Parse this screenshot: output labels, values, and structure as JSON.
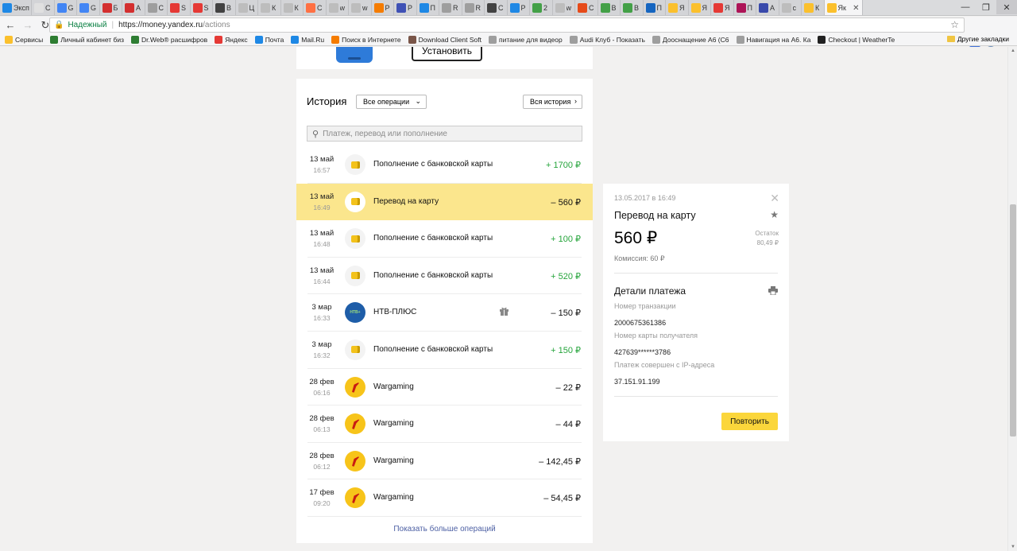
{
  "browser": {
    "tabs": [
      {
        "label": "Эксп",
        "color": "#1e88e5"
      },
      {
        "label": "C",
        "color": "#e0e0e0"
      },
      {
        "label": "G",
        "color": "#4285f4"
      },
      {
        "label": "G",
        "color": "#4285f4"
      },
      {
        "label": "Б",
        "color": "#d32f2f"
      },
      {
        "label": "А",
        "color": "#d32f2f"
      },
      {
        "label": "С",
        "color": "#9e9e9e"
      },
      {
        "label": "S",
        "color": "#e53935"
      },
      {
        "label": "S",
        "color": "#e53935"
      },
      {
        "label": "В",
        "color": "#424242"
      },
      {
        "label": "Ц",
        "color": "#bdbdbd"
      },
      {
        "label": "К",
        "color": "#bdbdbd"
      },
      {
        "label": "К",
        "color": "#bdbdbd"
      },
      {
        "label": "С",
        "color": "#ff7043"
      },
      {
        "label": "w",
        "color": "#bdbdbd"
      },
      {
        "label": "w",
        "color": "#bdbdbd"
      },
      {
        "label": "Р",
        "color": "#f57c00"
      },
      {
        "label": "Р",
        "color": "#3f51b5"
      },
      {
        "label": "П",
        "color": "#1e88e5"
      },
      {
        "label": "R",
        "color": "#9e9e9e"
      },
      {
        "label": "R",
        "color": "#9e9e9e"
      },
      {
        "label": "С",
        "color": "#424242"
      },
      {
        "label": "Р",
        "color": "#1e88e5"
      },
      {
        "label": "2",
        "color": "#43a047"
      },
      {
        "label": "w",
        "color": "#bdbdbd"
      },
      {
        "label": "С",
        "color": "#e64a19"
      },
      {
        "label": "В",
        "color": "#43a047"
      },
      {
        "label": "В",
        "color": "#43a047"
      },
      {
        "label": "П",
        "color": "#1565c0"
      },
      {
        "label": "Я",
        "color": "#fbc02d"
      },
      {
        "label": "Я",
        "color": "#fbc02d"
      },
      {
        "label": "Я",
        "color": "#e53935"
      },
      {
        "label": "П",
        "color": "#ad1457"
      },
      {
        "label": "А",
        "color": "#3949ab"
      },
      {
        "label": "c",
        "color": "#bdbdbd"
      },
      {
        "label": "К",
        "color": "#fbc02d"
      }
    ],
    "active_tab": {
      "label": "Як",
      "color": "#fbc02d"
    },
    "address": {
      "secure_label": "Надежный",
      "host": "https://money.yandex.ru",
      "path": "/actions"
    },
    "bookmarks": [
      {
        "label": "Сервисы",
        "color": "#fbc02d"
      },
      {
        "label": "Личный кабинет биз",
        "color": "#2e7d32"
      },
      {
        "label": "Dr.Web® расшифров",
        "color": "#2e7d32"
      },
      {
        "label": "Яндекс",
        "color": "#e53935"
      },
      {
        "label": "Почта",
        "color": "#1e88e5"
      },
      {
        "label": "Mail.Ru",
        "color": "#1e88e5"
      },
      {
        "label": "Поиск в Интернете",
        "color": "#f57c00"
      },
      {
        "label": "Download Client Soft",
        "color": "#795548"
      },
      {
        "label": "питание для видеор",
        "color": "#9e9e9e"
      },
      {
        "label": "Audi Клуб - Показать",
        "color": "#9e9e9e"
      },
      {
        "label": "Дооснащение А6 (С6",
        "color": "#9e9e9e"
      },
      {
        "label": "Навигация на А6. Ка",
        "color": "#9e9e9e"
      },
      {
        "label": "Checkout | WeatherTe",
        "color": "#212121"
      }
    ],
    "other_bookmarks": "Другие закладки"
  },
  "promo": {
    "install_label": "Установить"
  },
  "history": {
    "title": "История",
    "filter_label": "Все операции",
    "all_history_label": "Вся история",
    "search_placeholder": "Платеж, перевод или пополнение",
    "more_label": "Показать больше операций",
    "operations": [
      {
        "day": "13 май",
        "time": "16:57",
        "icon": "wallet",
        "name": "Пополнение с банковской карты",
        "amount": "+ 1700 ₽",
        "plus": true,
        "selected": false,
        "gift": false
      },
      {
        "day": "13 май",
        "time": "16:49",
        "icon": "wallet",
        "name": "Перевод на карту",
        "amount": "– 560 ₽",
        "plus": false,
        "selected": true,
        "gift": false
      },
      {
        "day": "13 май",
        "time": "16:48",
        "icon": "wallet",
        "name": "Пополнение с банковской карты",
        "amount": "+ 100 ₽",
        "plus": true,
        "selected": false,
        "gift": false
      },
      {
        "day": "13 май",
        "time": "16:44",
        "icon": "wallet",
        "name": "Пополнение с банковской карты",
        "amount": "+ 520 ₽",
        "plus": true,
        "selected": false,
        "gift": false
      },
      {
        "day": "3 мар",
        "time": "16:33",
        "icon": "ntv",
        "name": "НТВ-ПЛЮС",
        "amount": "– 150 ₽",
        "plus": false,
        "selected": false,
        "gift": true
      },
      {
        "day": "3 мар",
        "time": "16:32",
        "icon": "wallet",
        "name": "Пополнение с банковской карты",
        "amount": "+ 150 ₽",
        "plus": true,
        "selected": false,
        "gift": false
      },
      {
        "day": "28 фев",
        "time": "06:16",
        "icon": "wg",
        "name": "Wargaming",
        "amount": "– 22 ₽",
        "plus": false,
        "selected": false,
        "gift": false
      },
      {
        "day": "28 фев",
        "time": "06:13",
        "icon": "wg",
        "name": "Wargaming",
        "amount": "– 44 ₽",
        "plus": false,
        "selected": false,
        "gift": false
      },
      {
        "day": "28 фев",
        "time": "06:12",
        "icon": "wg",
        "name": "Wargaming",
        "amount": "– 142,45 ₽",
        "plus": false,
        "selected": false,
        "gift": false
      },
      {
        "day": "17 фев",
        "time": "09:20",
        "icon": "wg",
        "name": "Wargaming",
        "amount": "– 54,45 ₽",
        "plus": false,
        "selected": false,
        "gift": false
      }
    ]
  },
  "detail": {
    "datetime": "13.05.2017 в 16:49",
    "title": "Перевод на карту",
    "amount": "560 ₽",
    "balance_label": "Остаток",
    "balance": "80,49 ₽",
    "fee": "Комиссия: 60 ₽",
    "section_title": "Детали платежа",
    "transaction_label": "Номер транзакции",
    "transaction_value": "2000675361386",
    "card_label": "Номер карты получателя",
    "card_value": "427639******3786",
    "ip_label": "Платеж совершен с IP-адреса",
    "ip_value": "37.151.91.199",
    "repeat_label": "Повторить"
  },
  "colors": {
    "accent_yellow": "#fbd63b",
    "selected_row": "#fbe68d",
    "plus_green": "#25a43b",
    "link_blue": "#4c5fa3"
  }
}
